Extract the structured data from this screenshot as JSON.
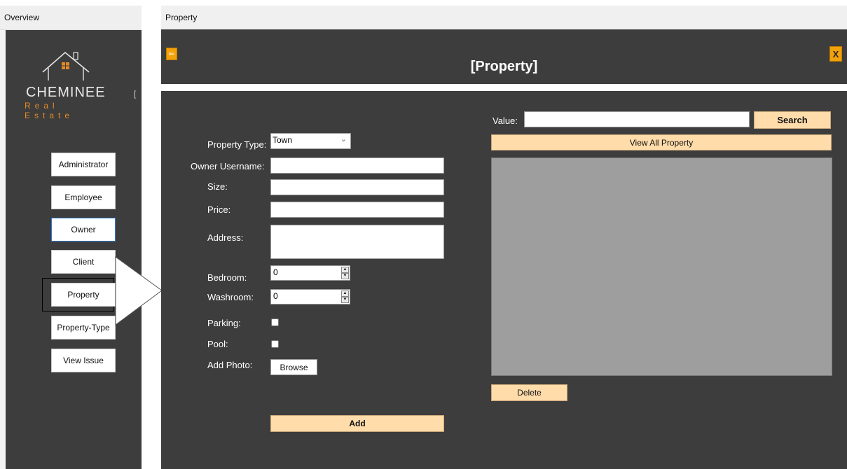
{
  "overview_window": {
    "title": "Overview",
    "logo": {
      "name": "CHEMINEE",
      "tagline": "Real Estate",
      "bracket": "["
    },
    "nav": [
      {
        "label": "Administrator"
      },
      {
        "label": "Employee"
      },
      {
        "label": "Owner"
      },
      {
        "label": "Client"
      },
      {
        "label": "Property"
      },
      {
        "label": "Property-Type"
      },
      {
        "label": "View Issue"
      }
    ],
    "selected": "Property"
  },
  "property_window": {
    "title": "Property",
    "header": "[Property]",
    "back_glyph": "⇐",
    "close_label": "X",
    "form": {
      "property_type_label": "Property Type:",
      "property_type_value": "Town",
      "owner_username_label": "Owner Username:",
      "size_label": "Size:",
      "price_label": "Price:",
      "address_label": "Address:",
      "bedroom_label": "Bedroom:",
      "bedroom_value": "0",
      "washroom_label": "Washroom:",
      "washroom_value": "0",
      "parking_label": "Parking:",
      "pool_label": "Pool:",
      "add_photo_label": "Add Photo:",
      "browse_label": "Browse",
      "add_label": "Add"
    },
    "search": {
      "value_label": "Value:",
      "search_label": "Search",
      "view_all_label": "View All Property",
      "delete_label": "Delete"
    }
  },
  "colors": {
    "panel_bg": "#3d3d3d",
    "accent_orange": "#f2a20a",
    "cream_button": "#ffdcaa",
    "grid_gray": "#9e9e9e",
    "logo_orange": "#e48a24"
  }
}
